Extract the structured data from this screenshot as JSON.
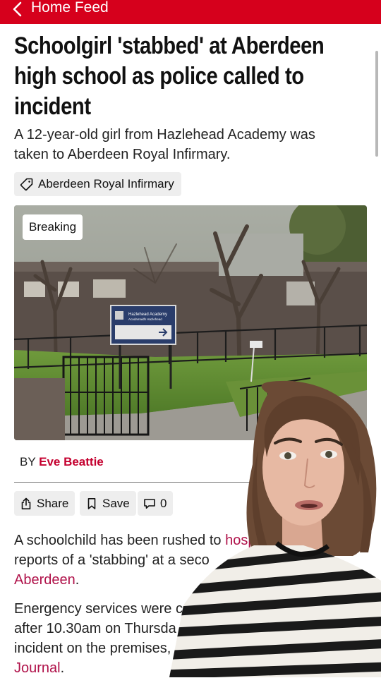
{
  "nav": {
    "back_label": "Home Feed"
  },
  "article": {
    "headline": "Schoolgirl 'stabbed' at Aberdeen high school as police called to incident",
    "standfirst": "A 12-year-old girl from Hazlehead Academy was taken to Aberdeen Royal Infirmary.",
    "tag": "Aberdeen Royal Infirmary",
    "image": {
      "badge": "Breaking",
      "sign_line1": "Hazlehead Academy",
      "sign_line2": "Acadamaidh Hazlehead"
    },
    "byline_prefix": "BY",
    "author": "Eve Beattie",
    "actions": {
      "share": "Share",
      "save": "Save",
      "comments": "0"
    },
    "para1": {
      "l1a": "A schoolchild has been rushed to ",
      "l1link": "hosp",
      "l2": "reports of a 'stabbing' at a seco",
      "l3link": "Aberdeen",
      "l3b": "."
    },
    "para2": {
      "l1": "Energency services were ca",
      "l2": "after 10.30am on Thursda",
      "l3": "incident on the premises,",
      "l4link": "Journal",
      "l4b": "."
    }
  },
  "colors": {
    "brand_red": "#d6001c",
    "link": "#b0124a",
    "author": "#c4002f",
    "chip_bg": "#eeeeee"
  },
  "icons": [
    "chevron-left-icon",
    "tag-icon",
    "share-icon",
    "bookmark-icon",
    "comment-icon"
  ]
}
